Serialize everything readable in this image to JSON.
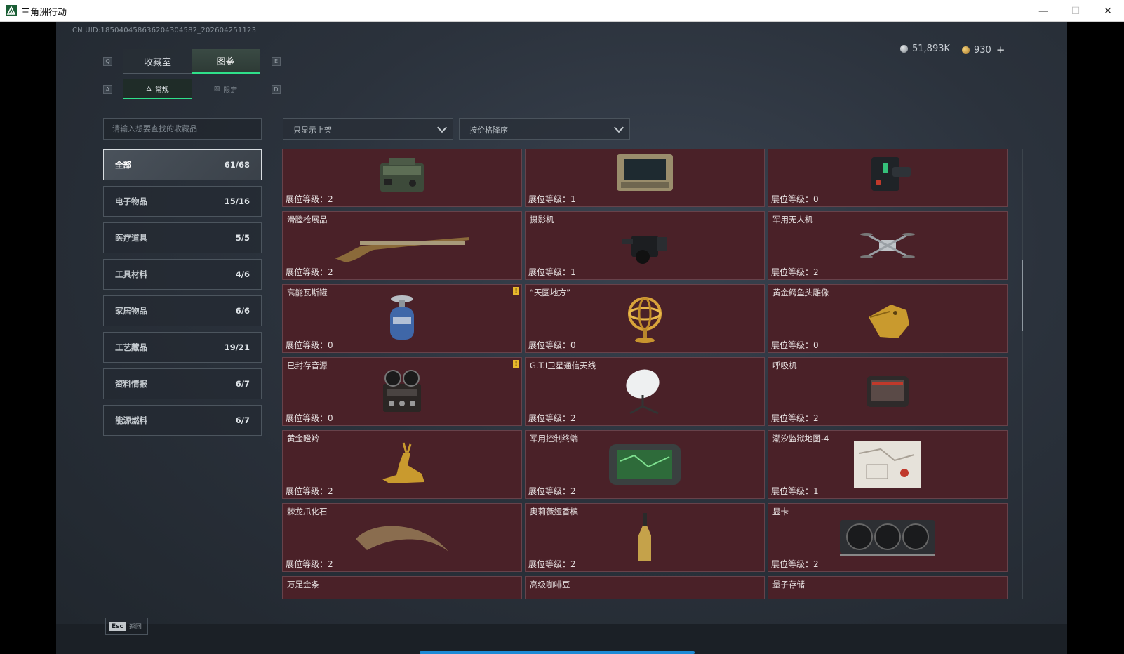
{
  "window": {
    "title": "三角洲行动",
    "minimize": "—",
    "maximize": "☐",
    "close": "✕"
  },
  "header": {
    "uid": "CN UID:1850404586362043045​82_202604251123",
    "currency1": "51,893K",
    "currency2": "930",
    "plus": "+"
  },
  "tabs": {
    "key_left": "Q",
    "key_right": "E",
    "items": [
      {
        "label": "收藏室",
        "active": false
      },
      {
        "label": "图鉴",
        "active": true
      }
    ]
  },
  "subtabs": {
    "key_left": "A",
    "key_right": "D",
    "items": [
      {
        "label": "常规",
        "active": true
      },
      {
        "label": "限定",
        "active": false
      }
    ]
  },
  "search": {
    "placeholder": "请输入想要查找的收藏品"
  },
  "filters": {
    "shelf_filter": "只显示上架",
    "sort": "按价格降序"
  },
  "categories": [
    {
      "label": "全部",
      "count": "61/68",
      "active": true
    },
    {
      "label": "电子物品",
      "count": "15/16"
    },
    {
      "label": "医疗道具",
      "count": "5/5"
    },
    {
      "label": "工具材料",
      "count": "4/6"
    },
    {
      "label": "家居物品",
      "count": "6/6"
    },
    {
      "label": "工艺藏品",
      "count": "19/21"
    },
    {
      "label": "资料情报",
      "count": "6/7"
    },
    {
      "label": "能源燃料",
      "count": "6/7"
    }
  ],
  "items": [
    {
      "name": "",
      "level": "展位等级：2",
      "icon": "radio-icon",
      "warn": false
    },
    {
      "name": "",
      "level": "展位等级：1",
      "icon": "rugged-laptop-icon",
      "warn": false
    },
    {
      "name": "",
      "level": "展位等级：0",
      "icon": "device-icon",
      "warn": false
    },
    {
      "name": "滑膛枪展品",
      "level": "展位等级：2",
      "icon": "musket-icon",
      "warn": false
    },
    {
      "name": "摄影机",
      "level": "展位等级：1",
      "icon": "camera-icon",
      "warn": false
    },
    {
      "name": "军用无人机",
      "level": "展位等级：2",
      "icon": "drone-icon",
      "warn": false
    },
    {
      "name": "高能瓦斯罐",
      "level": "展位等级：0",
      "icon": "gas-tank-icon",
      "warn": true
    },
    {
      "name": "“天圆地方”",
      "level": "展位等级：0",
      "icon": "armillary-icon",
      "warn": false
    },
    {
      "name": "黄金鳄鱼头雕像",
      "level": "展位等级：0",
      "icon": "gold-crocodile-icon",
      "warn": false
    },
    {
      "name": "已封存音源",
      "level": "展位等级：0",
      "icon": "tape-recorder-icon",
      "warn": true
    },
    {
      "name": "G.T.I卫星通信天线",
      "level": "展位等级：2",
      "icon": "satellite-dish-icon",
      "warn": false
    },
    {
      "name": "呼吸机",
      "level": "展位等级：2",
      "icon": "ventilator-icon",
      "warn": false
    },
    {
      "name": "黄金瞪羚",
      "level": "展位等级：2",
      "icon": "gold-gazelle-icon",
      "warn": false
    },
    {
      "name": "军用控制终端",
      "level": "展位等级：2",
      "icon": "control-terminal-icon",
      "warn": false
    },
    {
      "name": "潮汐监狱地图-4",
      "level": "展位等级：1",
      "icon": "map-icon",
      "warn": false
    },
    {
      "name": "棘龙爪化石",
      "level": "展位等级：2",
      "icon": "claw-fossil-icon",
      "warn": false
    },
    {
      "name": "奥莉薇娅香槟",
      "level": "展位等级：2",
      "icon": "champagne-icon",
      "warn": false
    },
    {
      "name": "显卡",
      "level": "展位等级：2",
      "icon": "graphics-card-icon",
      "warn": false
    },
    {
      "name": "万足金条",
      "level": "",
      "icon": "gold-bar-icon",
      "warn": false
    },
    {
      "name": "高级咖啡豆",
      "level": "",
      "icon": "coffee-icon",
      "warn": false
    },
    {
      "name": "量子存储",
      "level": "",
      "icon": "quantum-icon",
      "warn": false
    }
  ],
  "footer": {
    "esc_key": "Esc",
    "esc_label": "返回"
  }
}
